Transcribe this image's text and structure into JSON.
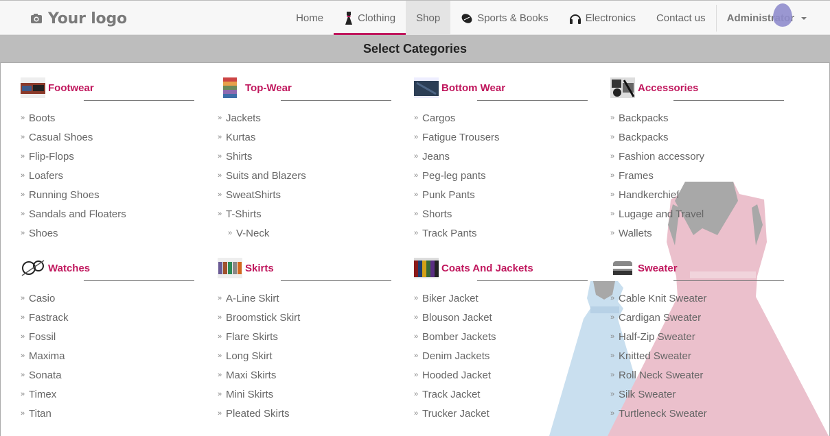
{
  "logo": {
    "text": "Your logo"
  },
  "nav": {
    "items": [
      {
        "label": "Home",
        "icon": ""
      },
      {
        "label": "Clothing",
        "icon": "dress-icon"
      },
      {
        "label": "Shop",
        "icon": ""
      },
      {
        "label": "Sports & Books",
        "icon": "football-icon"
      },
      {
        "label": "Electronics",
        "icon": "headphones-icon"
      },
      {
        "label": "Contact us",
        "icon": ""
      }
    ],
    "user": "Administrator"
  },
  "header": {
    "title": "Select Categories"
  },
  "categories": [
    {
      "name": "Footwear",
      "items": [
        "Boots",
        "Casual Shoes",
        "Flip-Flops",
        "Loafers",
        "Running Shoes",
        "Sandals and Floaters",
        "Shoes"
      ]
    },
    {
      "name": "Top-Wear",
      "items": [
        "Jackets",
        "Kurtas",
        "Shirts",
        "Suits and Blazers",
        "SweatShirts",
        "T-Shirts"
      ],
      "sub_item": "V-Neck"
    },
    {
      "name": "Bottom Wear",
      "items": [
        "Cargos",
        "Fatigue Trousers",
        "Jeans",
        "Peg-leg pants",
        "Punk Pants",
        "Shorts",
        "Track Pants"
      ]
    },
    {
      "name": "Accessories",
      "items": [
        "Backpacks",
        "Backpacks",
        "Fashion accessory",
        "Frames",
        "Handkerchief",
        "Lugage and Travel",
        "Wallets"
      ]
    },
    {
      "name": "Watches",
      "items": [
        "Casio",
        "Fastrack",
        "Fossil",
        "Maxima",
        "Sonata",
        "Timex",
        "Titan"
      ]
    },
    {
      "name": "Skirts",
      "items": [
        "A-Line Skirt",
        "Broomstick Skirt",
        "Flare Skirts",
        "Long Skirt",
        "Maxi Skirts",
        "Mini Skirts",
        "Pleated Skirts"
      ]
    },
    {
      "name": "Coats And Jackets",
      "items": [
        "Biker Jacket",
        "Blouson Jacket",
        "Bomber Jackets",
        "Denim Jackets",
        "Hooded Jacket",
        "Track Jacket",
        "Trucker Jacket"
      ]
    },
    {
      "name": "Sweater",
      "items": [
        "Cable Knit Sweater",
        "Cardigan Sweater",
        "Half-Zip Sweater",
        "Knitted Sweater",
        "Roll Neck Sweater",
        "Silk Sweater",
        "Turtleneck Sweater"
      ]
    }
  ],
  "colors": {
    "accent": "#c0175d",
    "header_bg": "#bdbdbd",
    "nav_bg": "#f7f7f7"
  }
}
